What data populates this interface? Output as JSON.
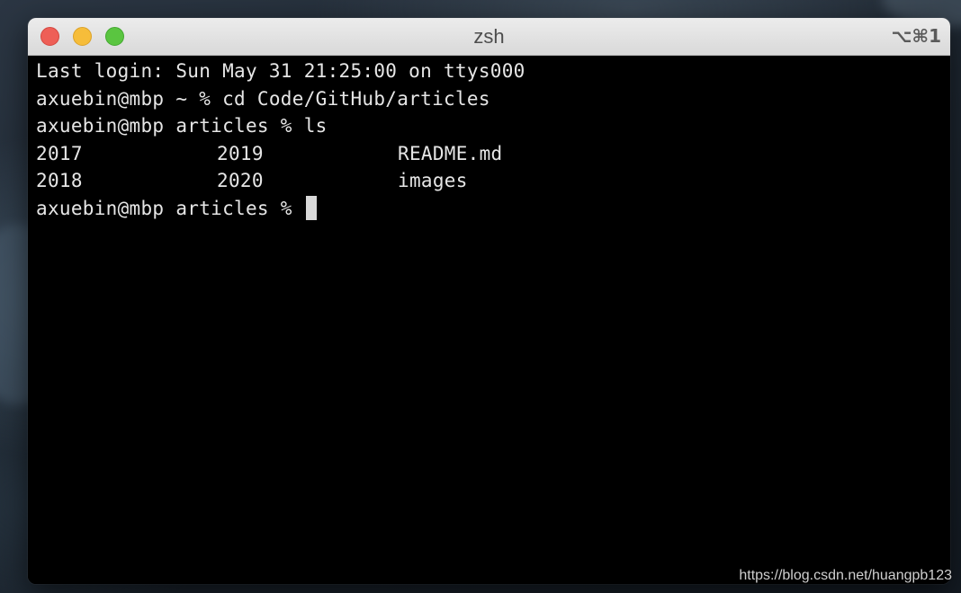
{
  "window": {
    "title": "zsh",
    "shortcut": "⌥⌘1",
    "controls": {
      "close_color": "#ee5f57",
      "minimize_color": "#f6bd3a",
      "zoom_color": "#5ac540"
    }
  },
  "terminal": {
    "last_login": "Last login: Sun May 31 21:25:00 on ttys000",
    "commands": [
      {
        "prompt": "axuebin@mbp ~ % ",
        "command": "cd Code/GitHub/articles"
      },
      {
        "prompt": "axuebin@mbp articles % ",
        "command": "ls"
      }
    ],
    "ls_output": [
      [
        "2017",
        "2019",
        "README.md"
      ],
      [
        "2018",
        "2020",
        "images"
      ]
    ],
    "current_prompt": "axuebin@mbp articles % "
  },
  "watermark": "https://blog.csdn.net/huangpb123"
}
